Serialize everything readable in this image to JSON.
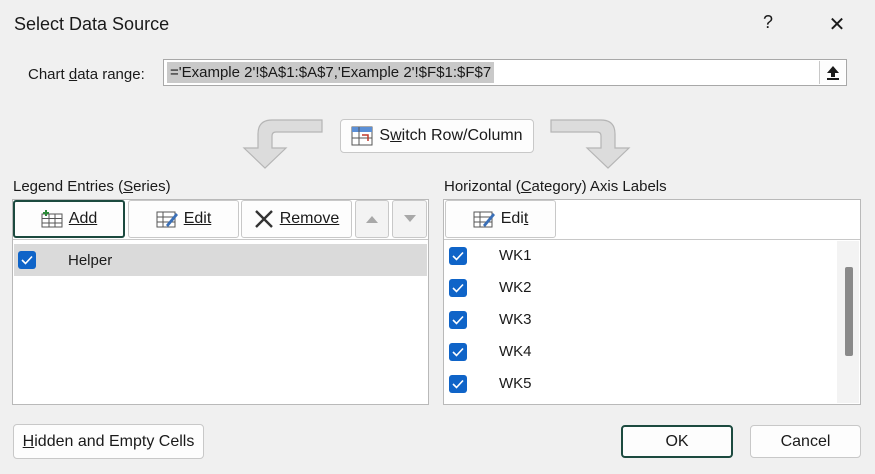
{
  "dialog": {
    "title": "Select Data Source",
    "help_label": "?",
    "close_label": "✕"
  },
  "range": {
    "label_prefix": "Chart ",
    "label_accel": "d",
    "label_suffix": "ata range:",
    "value": "='Example 2'!$A$1:$A$7,'Example 2'!$F$1:$F$7"
  },
  "switch_button": {
    "accel": "w",
    "prefix": "S",
    "suffix": "itch Row/Column"
  },
  "legend": {
    "title_prefix": "Legend Entries (",
    "title_accel": "S",
    "title_suffix": "eries)",
    "add_label": "Add",
    "edit_label": "Edit",
    "remove_label": "Remove",
    "series": [
      {
        "name": "Helper",
        "checked": true,
        "selected": true
      }
    ]
  },
  "axis": {
    "title_prefix": "Horizontal (",
    "title_accel": "C",
    "title_suffix": "ategory) Axis Labels",
    "edit_prefix": "Edi",
    "edit_accel": "t",
    "labels": [
      "WK1",
      "WK2",
      "WK3",
      "WK4",
      "WK5"
    ]
  },
  "footer": {
    "hidden_accel": "H",
    "hidden_suffix": "idden and Empty Cells",
    "ok_label": "OK",
    "cancel_label": "Cancel"
  }
}
